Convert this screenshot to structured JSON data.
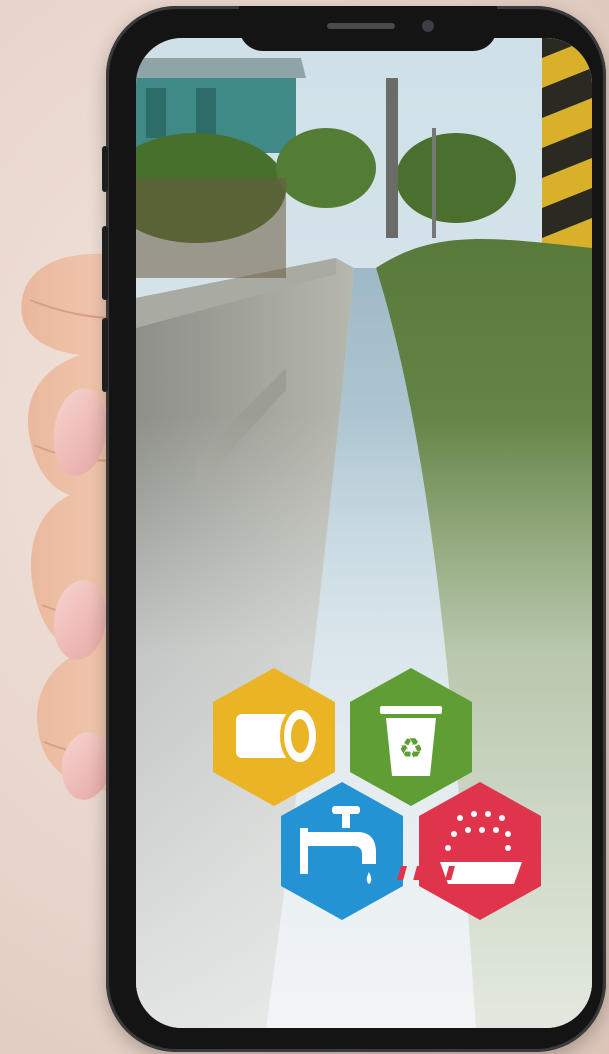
{
  "scene": {
    "description_visible": false
  },
  "phone": {
    "screen_image": "irrigation-ditch-photo",
    "logo_icons": [
      "pipe-icon",
      "recycle-bin-icon",
      "water-tap-icon",
      "rain-drain-icon"
    ]
  },
  "colors": {
    "background": "#ead9d0",
    "hex_yellow": "#eab424",
    "hex_green": "#5f9e34",
    "hex_blue": "#2393d3",
    "hex_red": "#e0344d",
    "phone_frame": "#141414"
  }
}
